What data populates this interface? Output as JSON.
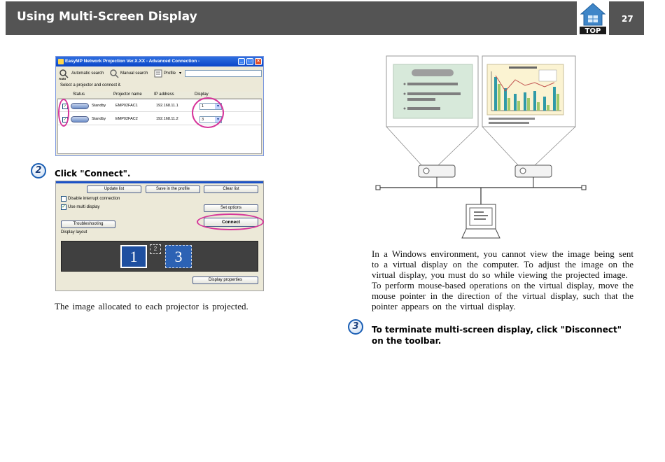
{
  "header": {
    "title": "Using Multi-Screen Display",
    "top_label": "TOP",
    "page_number": "27"
  },
  "screenshot1": {
    "title": "EasyMP Network Projection Ver.X.XX - Advanced Connection -",
    "toolbar": {
      "auto_search": "Automatic search",
      "auto_icon_label": "Auto",
      "manual_search": "Manual search",
      "profile": "Profile"
    },
    "prompt": "Select a projector and connect it.",
    "columns": [
      "Status",
      "Projector name",
      "IP address",
      "Display"
    ],
    "rows": [
      {
        "status": "Standby",
        "name": "EMP02FAC1",
        "ip": "192.168.11.1",
        "display": "1"
      },
      {
        "status": "Standby",
        "name": "EMP02FAC2",
        "ip": "192.168.11.2",
        "display": "3"
      }
    ]
  },
  "step2": {
    "number": "2",
    "text": "Click  \"Connect\"."
  },
  "screenshot2": {
    "update_list": "Update list",
    "save_profile": "Save in the profile",
    "clear_list": "Clear list",
    "disable_interrupt": "Disable interrupt connection",
    "use_multi_display": "Use multi display",
    "set_options": "Set options",
    "troubleshooting": "Troubleshooting",
    "connect": "Connect",
    "display_layout": "Display layout",
    "monitor_1": "1",
    "monitor_2": "2",
    "monitor_3": "3",
    "display_properties": "Display properties"
  },
  "caption_left": "The  image  allocated  to  each  projector  is  projected.",
  "paragraph1": "In a Windows environment, you cannot view the image being sent to a virtual display on the computer. To adjust the image on the virtual display, you must do so while viewing the projected image.",
  "paragraph2": "To perform mouse-based operations on the virtual display, move the mouse pointer in the direction of the virtual display, such that the pointer appears on the virtual display.",
  "step3": {
    "number": "3",
    "text": "To  terminate  multi-screen  display,  click  \"Disconnect\"  on  the toolbar."
  },
  "colors": {
    "header_bg": "#545454",
    "highlight_ring": "#d6349a",
    "step_ring": "#1b5fb4"
  }
}
